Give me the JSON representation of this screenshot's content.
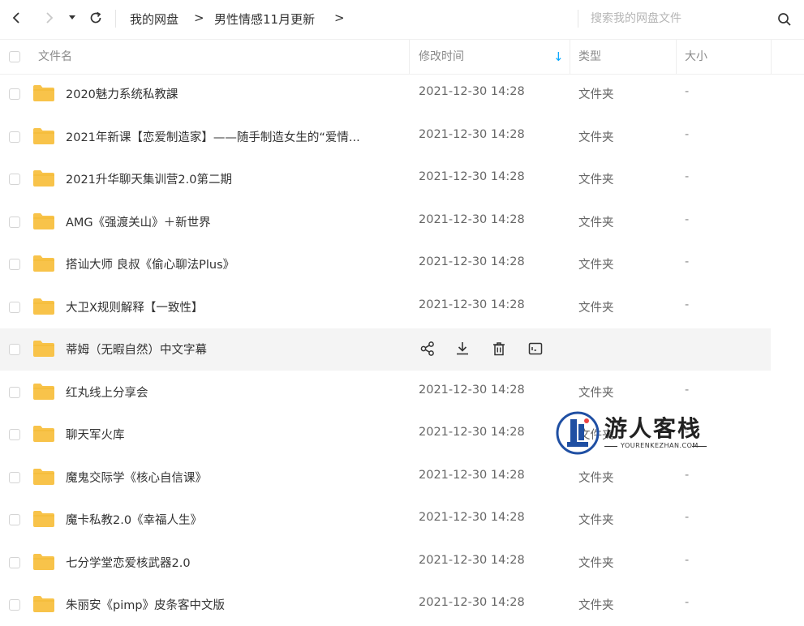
{
  "toolbar": {
    "back_icon": "chevron-left-icon",
    "forward_icon": "chevron-right-icon",
    "dropdown_icon": "caret-down-icon",
    "refresh_icon": "refresh-icon",
    "breadcrumb": [
      {
        "label": "我的网盘"
      },
      {
        "label": "男性情感11月更新"
      }
    ],
    "breadcrumb_separator": ">",
    "search_placeholder": "搜索我的网盘文件",
    "search_icon": "search-icon"
  },
  "table": {
    "columns": {
      "name": "文件名",
      "modified": "修改时间",
      "type": "类型",
      "size": "大小"
    },
    "sort_indicator": "↓",
    "rows": [
      {
        "name": "2020魅力系统私教課",
        "modified": "2021-12-30 14:28",
        "type": "文件夹",
        "size": "-"
      },
      {
        "name": "2021年新课【恋爱制造家】——随手制造女生的“爱情...",
        "modified": "2021-12-30 14:28",
        "type": "文件夹",
        "size": "-"
      },
      {
        "name": "2021升华聊天集训营2.0第二期",
        "modified": "2021-12-30 14:28",
        "type": "文件夹",
        "size": "-"
      },
      {
        "name": "AMG《强渡关山》＋新世界",
        "modified": "2021-12-30 14:28",
        "type": "文件夹",
        "size": "-"
      },
      {
        "name": "搭讪大师 良叔《偷心聊法Plus》",
        "modified": "2021-12-30 14:28",
        "type": "文件夹",
        "size": "-"
      },
      {
        "name": "大卫X规则解释【一致性】",
        "modified": "2021-12-30 14:28",
        "type": "文件夹",
        "size": "-"
      },
      {
        "name": "蒂姆（无暇自然）中文字幕",
        "modified": "",
        "type": "",
        "size": "",
        "hover": true
      },
      {
        "name": "红丸线上分享会",
        "modified": "2021-12-30 14:28",
        "type": "文件夹",
        "size": "-"
      },
      {
        "name": "聊天军火库",
        "modified": "2021-12-30 14:28",
        "type": "文件夹",
        "size": "-"
      },
      {
        "name": "魔鬼交际学《核心自信课》",
        "modified": "2021-12-30 14:28",
        "type": "文件夹",
        "size": "-"
      },
      {
        "name": "魔卡私教2.0《幸福人生》",
        "modified": "2021-12-30 14:28",
        "type": "文件夹",
        "size": "-"
      },
      {
        "name": "七分学堂恋爱核武器2.0",
        "modified": "2021-12-30 14:28",
        "type": "文件夹",
        "size": "-"
      },
      {
        "name": "朱丽安《pimp》皮条客中文版",
        "modified": "2021-12-30 14:28",
        "type": "文件夹",
        "size": "-"
      }
    ],
    "hover_actions": [
      "share-icon",
      "download-icon",
      "delete-icon",
      "rename-icon"
    ]
  },
  "watermark": {
    "title": "游人客栈",
    "subtitle": "YOURENKEZHAN.COM"
  },
  "colors": {
    "folder": "#F8C34A",
    "sort_arrow": "#06a7ff",
    "hover_row": "#f4f4f4"
  }
}
